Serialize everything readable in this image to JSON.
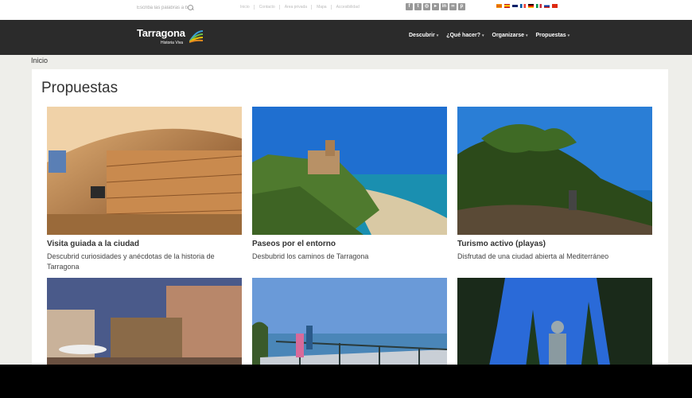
{
  "search": {
    "placeholder": "Escriba las palabras a bu"
  },
  "utility_links": [
    "Inicio",
    "Contacto",
    "Area privada",
    "Mapa",
    "Accesibilidad"
  ],
  "social_icons": [
    "facebook-icon",
    "twitter-icon",
    "instagram-icon",
    "youtube-icon",
    "linkedin-icon",
    "flickr-icon",
    "pinterest-icon"
  ],
  "language_flags": [
    "ca",
    "es",
    "en",
    "fr",
    "de",
    "it",
    "ru",
    "zh"
  ],
  "header": {
    "logo_title": "Tarragona",
    "logo_subtitle": "Historia Viva"
  },
  "nav": {
    "items": [
      {
        "label": "Descubrir"
      },
      {
        "label": "¿Qué hacer?"
      },
      {
        "label": "Organizarse"
      },
      {
        "label": "Propuestas"
      }
    ]
  },
  "breadcrumb": "Inicio",
  "page_title": "Propuestas",
  "cards": [
    {
      "title": "Visita guiada a la ciudad",
      "desc": "Descubrid curiosidades y anécdotas de la historia de Tarragona"
    },
    {
      "title": "Paseos por el entorno",
      "desc": "Desbubrid los caminos de Tarragona"
    },
    {
      "title": "Turismo activo (playas)",
      "desc": "Disfrutad de una ciudad abierta al Mediterráneo"
    },
    {
      "title": "",
      "desc": ""
    },
    {
      "title": "",
      "desc": ""
    },
    {
      "title": "",
      "desc": ""
    }
  ],
  "colors": {
    "header_bg": "#2b2b2b",
    "page_bg": "#eeeeea",
    "text": "#333333"
  }
}
